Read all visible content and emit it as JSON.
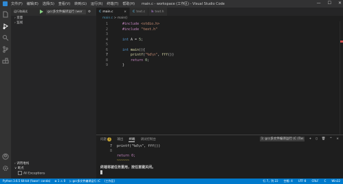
{
  "titlebar": {
    "menu": [
      "文件(F)",
      "编辑(E)",
      "选择(S)",
      "查看(V)",
      "转到(G)",
      "运行(R)",
      "终端(T)",
      "帮助(H)"
    ],
    "title": "main.c - workspace (工作区) - Visual Studio Code"
  },
  "sidebar": {
    "header": "运行和调试",
    "config": "gcc多文件编译运行 (wor",
    "sections": [
      "变量",
      "监视"
    ],
    "bottom": [
      "调用堆栈",
      "断点",
      "All Exceptions"
    ]
  },
  "tabs": [
    {
      "lang": "C",
      "name": "main.c",
      "close": "×"
    },
    {
      "lang": "C",
      "name": "text.c"
    },
    {
      "lang": "h",
      "name": "text.h"
    }
  ],
  "breadcrumb": {
    "file": "main.c",
    "sep": ">",
    "symbol": "main()"
  },
  "code_lines": [
    {
      "n": "1",
      "tokens": [
        {
          "t": "#include",
          "c": "kw"
        },
        {
          "t": " ",
          "c": "pl"
        },
        {
          "t": "<stdio.h>",
          "c": "st"
        }
      ]
    },
    {
      "n": "2",
      "tokens": [
        {
          "t": "#include",
          "c": "kw"
        },
        {
          "t": " ",
          "c": "pl"
        },
        {
          "t": "\"text.h\"",
          "c": "st"
        }
      ]
    },
    {
      "n": "3",
      "tokens": []
    },
    {
      "n": "4",
      "tokens": [
        {
          "t": "int",
          "c": "ty"
        },
        {
          "t": " A = ",
          "c": "pl"
        },
        {
          "t": "5",
          "c": "nm"
        },
        {
          "t": ";",
          "c": "pl"
        }
      ]
    },
    {
      "n": "5",
      "tokens": []
    },
    {
      "n": "6",
      "tokens": [
        {
          "t": "int",
          "c": "ty"
        },
        {
          "t": " ",
          "c": "pl"
        },
        {
          "t": "main",
          "c": "fn"
        },
        {
          "t": "(){",
          "c": "pl"
        }
      ]
    },
    {
      "n": "7",
      "tokens": [
        {
          "t": "    ",
          "c": "pl"
        },
        {
          "t": "printf",
          "c": "fn"
        },
        {
          "t": "(",
          "c": "pl"
        },
        {
          "t": "\"%d\\n\"",
          "c": "st"
        },
        {
          "t": ", ",
          "c": "pl"
        },
        {
          "t": "fff",
          "c": "fn"
        },
        {
          "t": "())",
          "c": "pl"
        }
      ]
    },
    {
      "n": "8",
      "tokens": [
        {
          "t": "    ",
          "c": "pl"
        },
        {
          "t": "return",
          "c": "kw"
        },
        {
          "t": " ",
          "c": "pl"
        },
        {
          "t": "0",
          "c": "nm"
        },
        {
          "t": ";",
          "c": "pl"
        }
      ]
    },
    {
      "n": "9",
      "tokens": [
        {
          "t": "}",
          "c": "pl"
        }
      ]
    }
  ],
  "current_line": "7",
  "panel": {
    "tabs": [
      "问题",
      "输出",
      "终端",
      "调试控制台"
    ],
    "problems_count": "1",
    "active_tab": "终端",
    "terminal_select": "1: gcc多文件编译运行 (C (Tas",
    "lines": [
      {
        "n": "7",
        "text": "printf(\"%d\\n\", fff())"
      },
      {
        "n": "8",
        "text": ""
      },
      {
        "n": "",
        "text": "return 0;"
      },
      {
        "n": "",
        "text": "~~~~~~"
      }
    ],
    "message": "终端将被任务重用，按任意键关闭。"
  },
  "statusbar": {
    "left": [
      "Python 3.6.5 64-bit ('base': conda)",
      "⊗ 1 ⚠ 0",
      "▷ gcc多文件编译运行 (C",
      "(工作区)"
    ],
    "right": [
      "行 7，列 22",
      "空格: 4",
      "UTF-8",
      "CRLF",
      "C",
      "Win32"
    ]
  }
}
